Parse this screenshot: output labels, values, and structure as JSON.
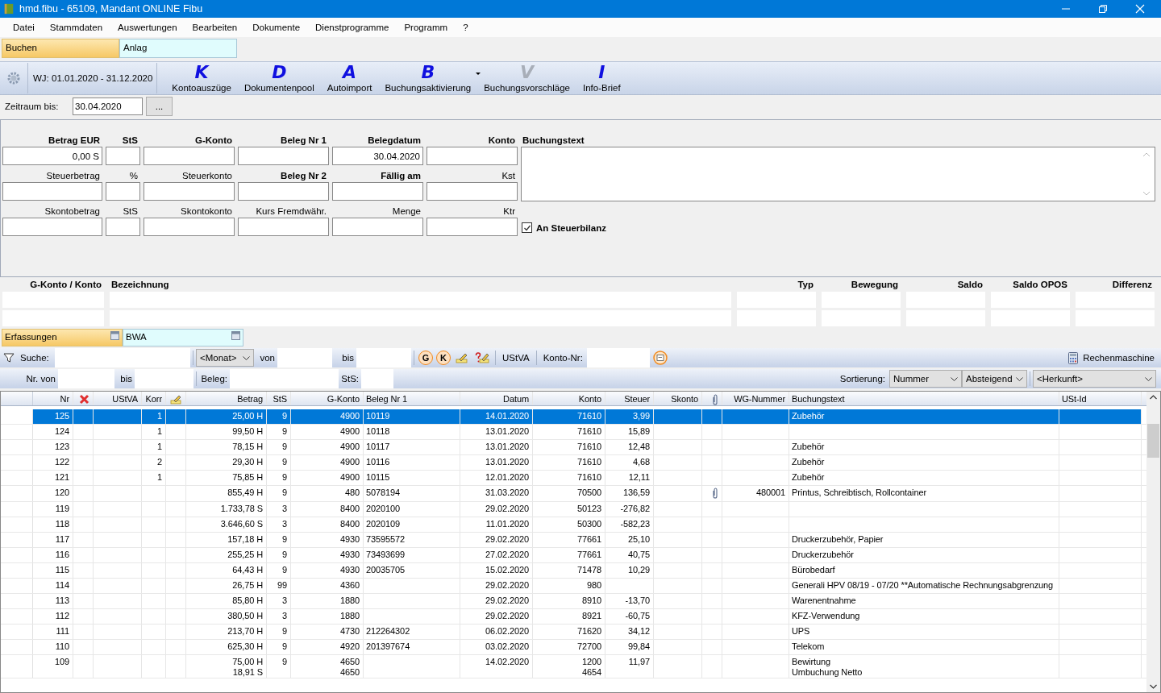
{
  "window": {
    "title": "hmd.fibu - 65109, Mandant ONLINE Fibu"
  },
  "menu": [
    "Datei",
    "Stammdaten",
    "Auswertungen",
    "Bearbeiten",
    "Dokumente",
    "Dienstprogramme",
    "Programm",
    "?"
  ],
  "module_tabs": [
    {
      "label": "Buchen",
      "selected": true
    },
    {
      "label": "Anlag",
      "selected": false
    }
  ],
  "toolbar": {
    "fiscal_year": "WJ: 01.01.2020 - 31.12.2020",
    "buttons": [
      {
        "letter": "K",
        "label": "Kontoauszüge",
        "disabled": false,
        "dropdown": false
      },
      {
        "letter": "D",
        "label": "Dokumentenpool",
        "disabled": false,
        "dropdown": false
      },
      {
        "letter": "A",
        "label": "Autoimport",
        "disabled": false,
        "dropdown": false
      },
      {
        "letter": "B",
        "label": "Buchungsaktivierung",
        "disabled": false,
        "dropdown": true
      },
      {
        "letter": "V",
        "label": "Buchungsvorschläge",
        "disabled": true,
        "dropdown": false
      },
      {
        "letter": "I",
        "label": "Info-Brief",
        "disabled": false,
        "dropdown": false
      }
    ]
  },
  "period": {
    "label": "Zeitraum bis:",
    "value": "30.04.2020",
    "button": "..."
  },
  "entry_form": {
    "rows": [
      [
        {
          "label": "Betrag EUR",
          "bold": true,
          "value": "0,00 S"
        },
        {
          "label": "StS",
          "bold": true
        },
        {
          "label": "G-Konto",
          "bold": true
        },
        {
          "label": "Beleg Nr 1",
          "bold": true
        },
        {
          "label": "Belegdatum",
          "bold": true,
          "value": "30.04.2020"
        },
        {
          "label": "Konto",
          "bold": true
        }
      ],
      [
        {
          "label": "Steuerbetrag",
          "bold": false
        },
        {
          "label": "%",
          "bold": false
        },
        {
          "label": "Steuerkonto",
          "bold": false
        },
        {
          "label": "Beleg Nr 2",
          "bold": true
        },
        {
          "label": "Fällig am",
          "bold": true
        },
        {
          "label": "Kst",
          "bold": false
        }
      ],
      [
        {
          "label": "Skontobetrag",
          "bold": false
        },
        {
          "label": "StS",
          "bold": false
        },
        {
          "label": "Skontokonto",
          "bold": false
        },
        {
          "label": "Kurs Fremdwähr.",
          "bold": false
        },
        {
          "label": "Menge",
          "bold": false
        },
        {
          "label": "Ktr",
          "bold": false
        }
      ]
    ],
    "text_label": "Buchungstext",
    "checkbox": {
      "label": "An Steuerbilanz",
      "checked": true
    }
  },
  "account_panel": {
    "columns": [
      "G-Konto / Konto",
      "Bezeichnung",
      "Typ",
      "Bewegung",
      "Saldo",
      "Saldo OPOS",
      "Differenz"
    ]
  },
  "list_tabs": [
    {
      "label": "Erfassungen",
      "selected": true
    },
    {
      "label": "BWA",
      "selected": false
    }
  ],
  "filter": {
    "search_label": "Suche:",
    "month": "<Monat>",
    "from": "von",
    "to": "bis",
    "buttons": [
      "G",
      "K"
    ],
    "ustva": "UStVA",
    "account_label": "Konto-Nr:",
    "calculator": "Rechenmaschine",
    "nr_from": "Nr. von",
    "nr_to": "bis",
    "beleg": "Beleg:",
    "sts": "StS:",
    "sort_label": "Sortierung:",
    "sort_field": "Nummer",
    "sort_order": "Absteigend",
    "origin": "<Herkunft>"
  },
  "table": {
    "columns": [
      {
        "label": "Nr",
        "kind": "text"
      },
      {
        "kind": "delete"
      },
      {
        "label": "UStVA",
        "kind": "text"
      },
      {
        "label": "Korr",
        "kind": "text"
      },
      {
        "kind": "edit"
      },
      {
        "label": "Betrag",
        "kind": "text"
      },
      {
        "label": "StS",
        "kind": "text"
      },
      {
        "label": "G-Konto",
        "kind": "text"
      },
      {
        "label": "Beleg Nr 1",
        "kind": "text"
      },
      {
        "label": "Datum",
        "kind": "text"
      },
      {
        "label": "Konto",
        "kind": "text"
      },
      {
        "label": "Steuer",
        "kind": "text"
      },
      {
        "label": "Skonto",
        "kind": "text"
      },
      {
        "kind": "attachment"
      },
      {
        "label": "WG-Nummer",
        "kind": "text"
      },
      {
        "label": "Buchungstext",
        "kind": "text"
      },
      {
        "label": "USt-Id",
        "kind": "text"
      }
    ],
    "rows": [
      {
        "nr": "125",
        "korr": "1",
        "betrag": "25,00 H",
        "sts": "9",
        "g_konto": "4900",
        "beleg_nr_1": "10119",
        "datum": "14.01.2020",
        "konto": "71610",
        "steuer": "3,99",
        "attachment": false,
        "buchungstext": "Zubehör",
        "selected": true
      },
      {
        "nr": "124",
        "korr": "1",
        "betrag": "99,50 H",
        "sts": "9",
        "g_konto": "4900",
        "beleg_nr_1": "10118",
        "datum": "13.01.2020",
        "konto": "71610",
        "steuer": "15,89",
        "attachment": false,
        "selected": false
      },
      {
        "nr": "123",
        "korr": "1",
        "betrag": "78,15 H",
        "sts": "9",
        "g_konto": "4900",
        "beleg_nr_1": "10117",
        "datum": "13.01.2020",
        "konto": "71610",
        "steuer": "12,48",
        "attachment": false,
        "buchungstext": "Zubehör",
        "selected": false
      },
      {
        "nr": "122",
        "korr": "2",
        "betrag": "29,30 H",
        "sts": "9",
        "g_konto": "4900",
        "beleg_nr_1": "10116",
        "datum": "13.01.2020",
        "konto": "71610",
        "steuer": "4,68",
        "attachment": false,
        "buchungstext": "Zubehör",
        "selected": false
      },
      {
        "nr": "121",
        "korr": "1",
        "betrag": "75,85 H",
        "sts": "9",
        "g_konto": "4900",
        "beleg_nr_1": "10115",
        "datum": "12.01.2020",
        "konto": "71610",
        "steuer": "12,11",
        "attachment": false,
        "buchungstext": "Zubehör",
        "selected": false
      },
      {
        "nr": "120",
        "betrag": "855,49 H",
        "sts": "9",
        "g_konto": "480",
        "beleg_nr_1": "5078194",
        "datum": "31.03.2020",
        "konto": "70500",
        "steuer": "136,59",
        "attachment": true,
        "wg_nummer": "480001",
        "buchungstext": "Printus, Schreibtisch, Rollcontainer",
        "selected": false
      },
      {
        "nr": "119",
        "betrag": "1.733,78 S",
        "sts": "3",
        "g_konto": "8400",
        "beleg_nr_1": "2020100",
        "datum": "29.02.2020",
        "konto": "50123",
        "steuer": "-276,82",
        "attachment": false,
        "selected": false
      },
      {
        "nr": "118",
        "betrag": "3.646,60 S",
        "sts": "3",
        "g_konto": "8400",
        "beleg_nr_1": "2020109",
        "datum": "11.01.2020",
        "konto": "50300",
        "steuer": "-582,23",
        "attachment": false,
        "selected": false
      },
      {
        "nr": "117",
        "betrag": "157,18 H",
        "sts": "9",
        "g_konto": "4930",
        "beleg_nr_1": "73595572",
        "datum": "29.02.2020",
        "konto": "77661",
        "steuer": "25,10",
        "attachment": false,
        "buchungstext": "Druckerzubehör, Papier",
        "selected": false
      },
      {
        "nr": "116",
        "betrag": "255,25 H",
        "sts": "9",
        "g_konto": "4930",
        "beleg_nr_1": "73493699",
        "datum": "27.02.2020",
        "konto": "77661",
        "steuer": "40,75",
        "attachment": false,
        "buchungstext": "Druckerzubehör",
        "selected": false
      },
      {
        "nr": "115",
        "betrag": "64,43 H",
        "sts": "9",
        "g_konto": "4930",
        "beleg_nr_1": "20035705",
        "datum": "15.02.2020",
        "konto": "71478",
        "steuer": "10,29",
        "attachment": false,
        "buchungstext": "Bürobedarf",
        "selected": false
      },
      {
        "nr": "114",
        "betrag": "26,75 H",
        "sts": "99",
        "g_konto": "4360",
        "datum": "29.02.2020",
        "konto": "980",
        "attachment": false,
        "buchungstext": "Generali HPV 08/19 - 07/20 **Automatische Rechnungsabgrenzung",
        "selected": false
      },
      {
        "nr": "113",
        "betrag": "85,80 H",
        "sts": "3",
        "g_konto": "1880",
        "datum": "29.02.2020",
        "konto": "8910",
        "steuer": "-13,70",
        "attachment": false,
        "buchungstext": "Warenentnahme",
        "selected": false
      },
      {
        "nr": "112",
        "betrag": "380,50 H",
        "sts": "3",
        "g_konto": "1880",
        "datum": "29.02.2020",
        "konto": "8921",
        "steuer": "-60,75",
        "attachment": false,
        "buchungstext": "KFZ-Verwendung",
        "selected": false
      },
      {
        "nr": "111",
        "betrag": "213,70 H",
        "sts": "9",
        "g_konto": "4730",
        "beleg_nr_1": "212264302",
        "datum": "06.02.2020",
        "konto": "71620",
        "steuer": "34,12",
        "attachment": false,
        "buchungstext": "UPS",
        "selected": false
      },
      {
        "nr": "110",
        "betrag": "625,30 H",
        "sts": "9",
        "g_konto": "4920",
        "beleg_nr_1": "201397674",
        "datum": "03.02.2020",
        "konto": "72700",
        "steuer": "99,84",
        "attachment": false,
        "buchungstext": "Telekom",
        "selected": false
      },
      {
        "nr": "109",
        "betrag": "75,00 H\n18,91 S",
        "sts": "9",
        "g_konto": "4650\n4650",
        "datum": "14.02.2020",
        "konto": "1200\n4654",
        "steuer": "11,97",
        "attachment": false,
        "buchungstext": "Bewirtung\nUmbuchung Netto",
        "selected": false
      }
    ]
  }
}
